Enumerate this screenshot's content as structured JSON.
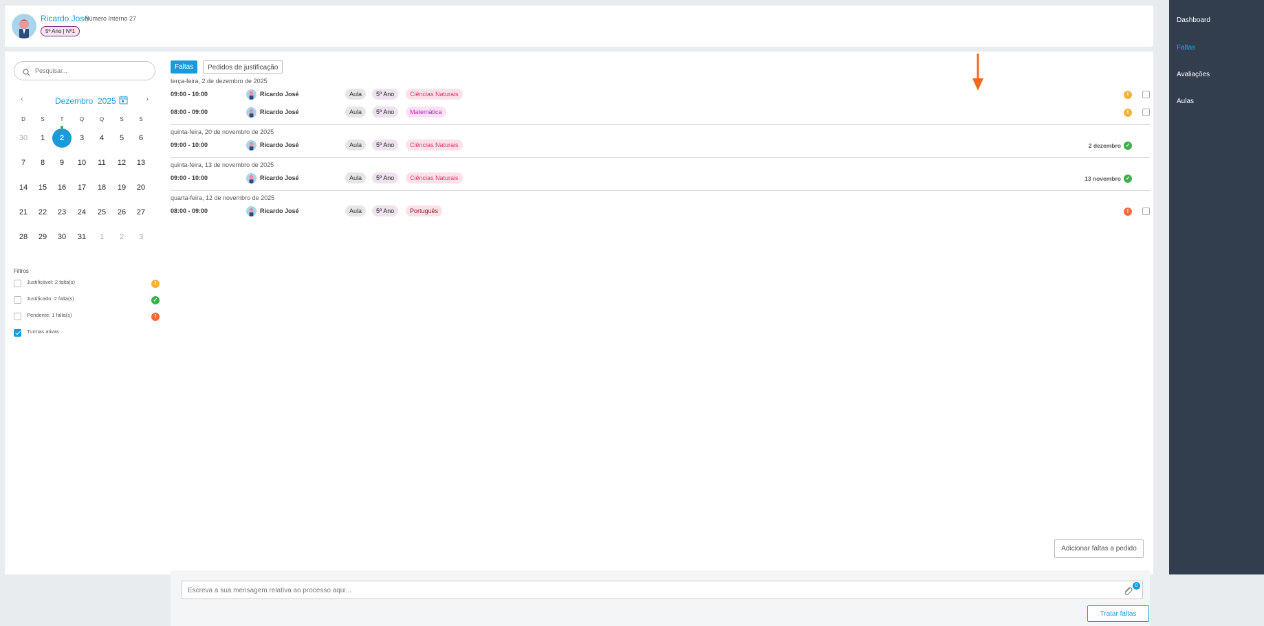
{
  "student": {
    "name": "Ricardo José",
    "internal_number": "Número Interno 27",
    "class_badge": "5º Ano | Nº1"
  },
  "search": {
    "placeholder": "Pesquisar..."
  },
  "calendar": {
    "prev": "‹",
    "next": "›",
    "month": "Dezembro",
    "year": "2025",
    "weekdays": [
      "D",
      "S",
      "T",
      "Q",
      "Q",
      "S",
      "S"
    ],
    "weeks": [
      [
        "30",
        "1",
        "2",
        "3",
        "4",
        "5",
        "6"
      ],
      [
        "7",
        "8",
        "9",
        "10",
        "11",
        "12",
        "13"
      ],
      [
        "14",
        "15",
        "16",
        "17",
        "18",
        "19",
        "20"
      ],
      [
        "21",
        "22",
        "23",
        "24",
        "25",
        "26",
        "27"
      ],
      [
        "28",
        "29",
        "30",
        "31",
        "1",
        "2",
        "3"
      ]
    ],
    "today": "2"
  },
  "filters": {
    "title": "Filtros",
    "items": [
      {
        "label": "Justificável: 2 falta(s)",
        "checked": false,
        "status": "orange"
      },
      {
        "label": "Justificado: 2 falta(s)",
        "checked": false,
        "status": "green"
      },
      {
        "label": "Pendente: 1 falta(s)",
        "checked": false,
        "status": "red"
      },
      {
        "label": "Turmas ativas",
        "checked": true,
        "status": ""
      }
    ]
  },
  "tabs": {
    "active": "Faltas",
    "other": "Pedidos de justificação"
  },
  "groups": [
    {
      "date": "terça-feira, 2 de dezembro de 2025",
      "rows": [
        {
          "time": "09:00 - 10:00",
          "name": "Ricardo José",
          "type": "Aula",
          "class": "5º Ano",
          "subject": "Ciências Naturais",
          "subject_color": "cn",
          "status": "orange",
          "justified_date": "",
          "checkbox": true
        },
        {
          "time": "08:00 - 09:00",
          "name": "Ricardo José",
          "type": "Aula",
          "class": "5º Ano",
          "subject": "Matemática",
          "subject_color": "mat",
          "status": "orange",
          "justified_date": "",
          "checkbox": true
        }
      ]
    },
    {
      "date": "quinta-feira, 20 de novembro de 2025",
      "rows": [
        {
          "time": "09:00 - 10:00",
          "name": "Ricardo José",
          "type": "Aula",
          "class": "5º Ano",
          "subject": "Ciências Naturais",
          "subject_color": "cn",
          "status": "green",
          "justified_date": "2 dezembro",
          "checkbox": false
        }
      ]
    },
    {
      "date": "quinta-feira, 13 de novembro de 2025",
      "rows": [
        {
          "time": "09:00 - 10:00",
          "name": "Ricardo José",
          "type": "Aula",
          "class": "5º Ano",
          "subject": "Ciências Naturais",
          "subject_color": "cn",
          "status": "green",
          "justified_date": "13 novembro",
          "checkbox": false
        }
      ]
    },
    {
      "date": "quarta-feira, 12 de novembro de 2025",
      "rows": [
        {
          "time": "08:00 - 09:00",
          "name": "Ricardo José",
          "type": "Aula",
          "class": "5º Ano",
          "subject": "Português",
          "subject_color": "pt",
          "status": "red",
          "justified_date": "",
          "checkbox": true
        }
      ]
    }
  ],
  "add_button": "Adicionar faltas a pedido",
  "message": {
    "placeholder": "Escreva a sua mensagem relativa ao processo aqui...",
    "attachments": "0"
  },
  "submit_button": "Tratar faltas",
  "sidebar": {
    "items": [
      {
        "label": "Dashboard",
        "active": false
      },
      {
        "label": "Faltas",
        "active": true
      },
      {
        "label": "Avaliações",
        "active": false
      },
      {
        "label": "Aulas",
        "active": false
      }
    ]
  },
  "colors": {
    "accent": "#1a9ad6",
    "sidebar": "#323d4e",
    "orange": "#f0b43a",
    "green": "#3cb04a",
    "red": "#ee6b3e",
    "arrow": "#f06a1e"
  }
}
